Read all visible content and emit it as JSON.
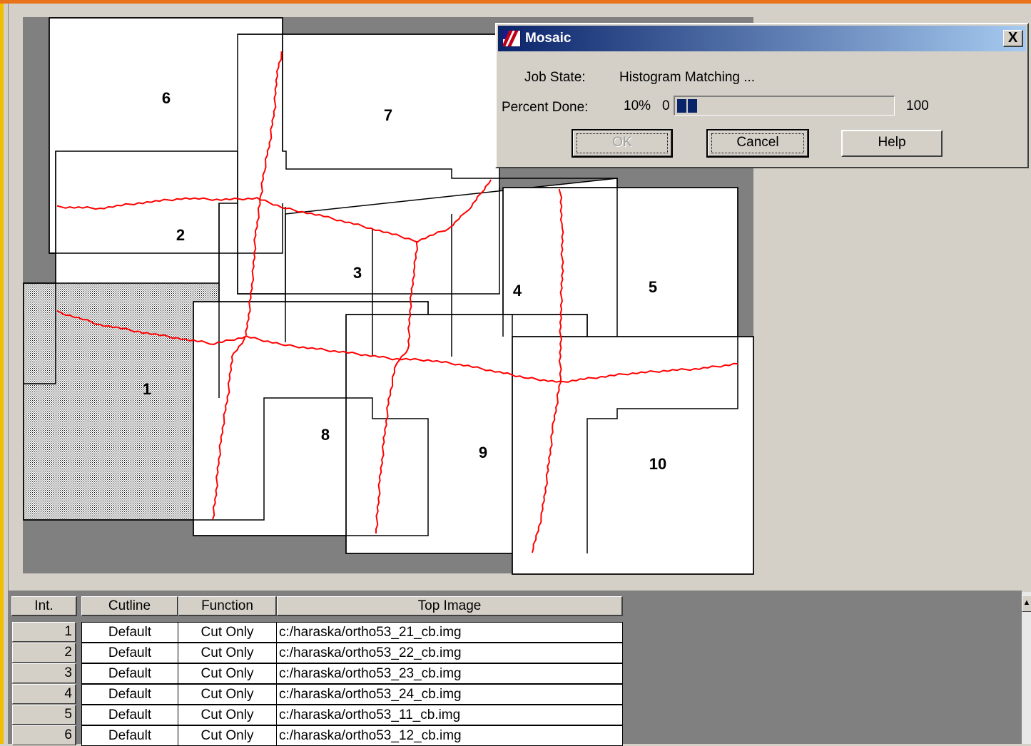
{
  "dialog": {
    "title": "Mosaic",
    "close_label": "X",
    "job_state_label": "Job State:",
    "job_state_value": "Histogram Matching ...",
    "percent_done_label": "Percent Done:",
    "percent_value_text": "10%",
    "progress_min_label": "0",
    "progress_max_label": "100",
    "progress_fraction": 0.1,
    "buttons": {
      "ok": "OK",
      "cancel": "Cancel",
      "help": "Help"
    }
  },
  "mosaic": {
    "image_labels": [
      "1",
      "2",
      "3",
      "4",
      "5",
      "6",
      "7",
      "8",
      "9",
      "10"
    ],
    "cutline_color": "#ff0000",
    "background_color": "#808080"
  },
  "table": {
    "headers": {
      "int": "Int.",
      "cutline": "Cutline",
      "function": "Function",
      "top_image": "Top Image"
    },
    "rows": [
      {
        "int": "1",
        "cutline": "Default",
        "function": "Cut Only",
        "top_image": "c:/haraska/ortho53_21_cb.img"
      },
      {
        "int": "2",
        "cutline": "Default",
        "function": "Cut Only",
        "top_image": "c:/haraska/ortho53_22_cb.img"
      },
      {
        "int": "3",
        "cutline": "Default",
        "function": "Cut Only",
        "top_image": "c:/haraska/ortho53_23_cb.img"
      },
      {
        "int": "4",
        "cutline": "Default",
        "function": "Cut Only",
        "top_image": "c:/haraska/ortho53_24_cb.img"
      },
      {
        "int": "5",
        "cutline": "Default",
        "function": "Cut Only",
        "top_image": "c:/haraska/ortho53_11_cb.img"
      },
      {
        "int": "6",
        "cutline": "Default",
        "function": "Cut Only",
        "top_image": "c:/haraska/ortho53_12_cb.img"
      }
    ]
  },
  "colors": {
    "title_bar": "#0a246a",
    "window_frame": "#e8731a",
    "progress": "#0a246a"
  }
}
